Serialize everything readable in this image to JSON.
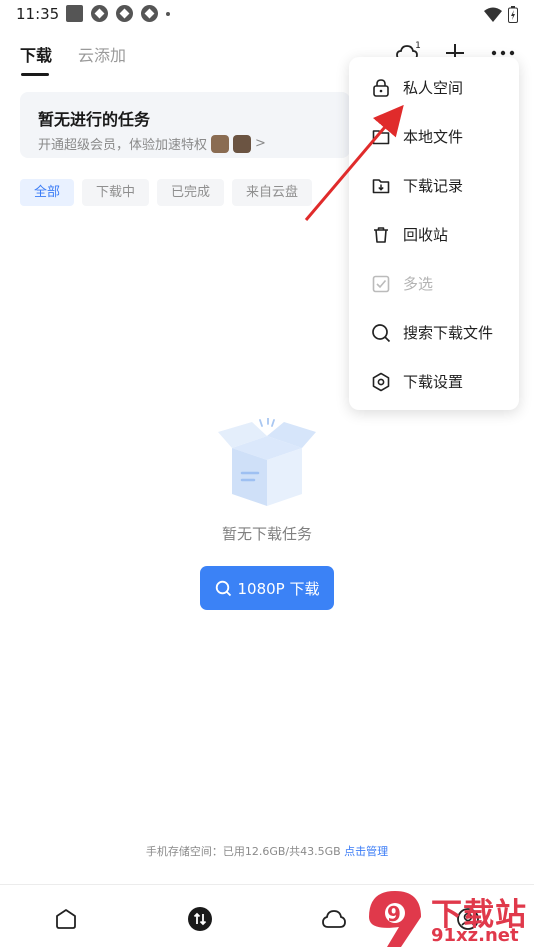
{
  "status_bar": {
    "time": "11:35"
  },
  "tabs": [
    {
      "label": "下载",
      "active": true
    },
    {
      "label": "云添加",
      "active": false
    }
  ],
  "top_actions": {
    "cloud_badge": "1"
  },
  "promo": {
    "title": "暂无进行的任务",
    "subtitle": "开通超级会员，体验加速特权",
    "more": ">"
  },
  "filters": [
    {
      "label": "全部",
      "active": true
    },
    {
      "label": "下载中",
      "active": false
    },
    {
      "label": "已完成",
      "active": false
    },
    {
      "label": "来自云盘",
      "active": false
    }
  ],
  "menu": [
    {
      "label": "私人空间",
      "icon": "lock-icon",
      "enabled": true
    },
    {
      "label": "本地文件",
      "icon": "folder-icon",
      "enabled": true
    },
    {
      "label": "下载记录",
      "icon": "download-folder-icon",
      "enabled": true
    },
    {
      "label": "回收站",
      "icon": "trash-icon",
      "enabled": true
    },
    {
      "label": "多选",
      "icon": "checkbox-icon",
      "enabled": false
    },
    {
      "label": "搜索下载文件",
      "icon": "search-icon",
      "enabled": true
    },
    {
      "label": "下载设置",
      "icon": "settings-hexagon-icon",
      "enabled": true
    }
  ],
  "empty_state": {
    "text": "暂无下载任务"
  },
  "cta": {
    "label": "1080P 下载"
  },
  "storage": {
    "text": "手机存储空间：已用12.6GB/共43.5GB",
    "link": "点击管理"
  },
  "watermark": {
    "text": "下载站",
    "url": "91xz.net",
    "logo": "9"
  },
  "colors": {
    "accent": "#3b82f6",
    "annotation_arrow": "#e02b2b",
    "watermark": "#e0394b"
  }
}
